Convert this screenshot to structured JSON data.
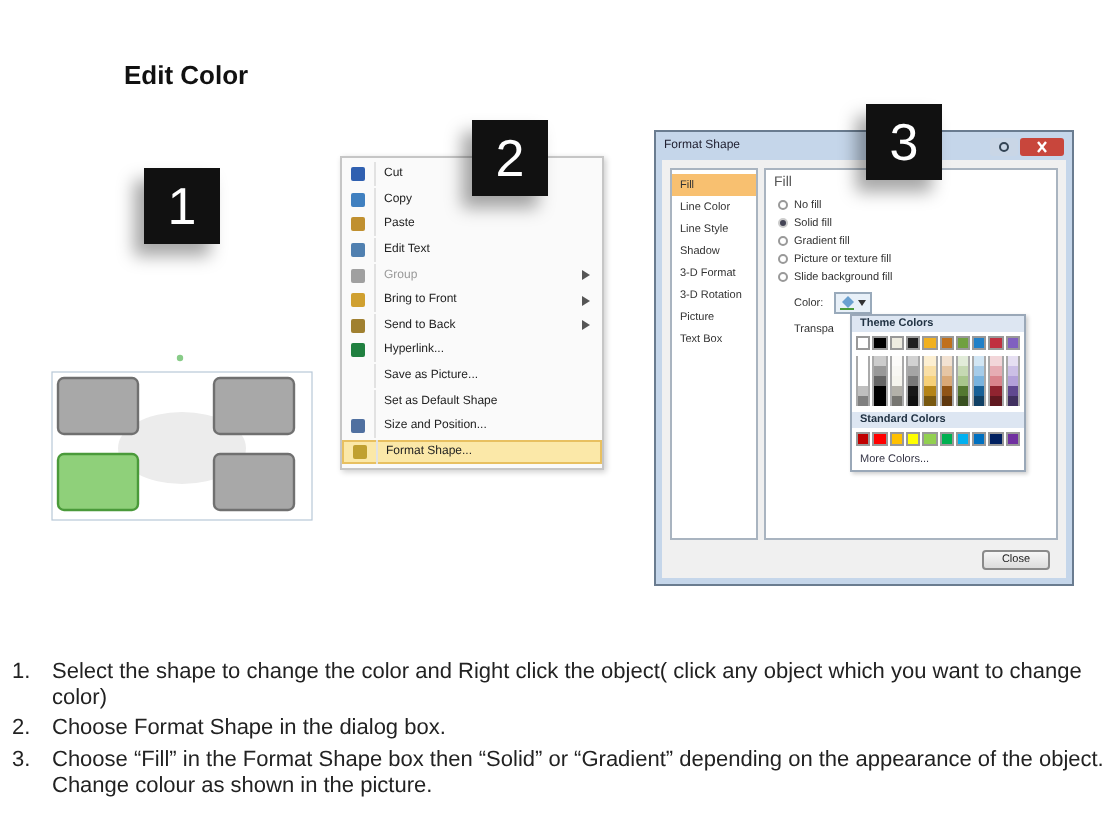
{
  "title": "Edit Color",
  "diagram": {
    "badge": "1",
    "shapes": [
      {
        "selected": false
      },
      {
        "selected": false
      },
      {
        "selected": true
      },
      {
        "selected": false
      }
    ]
  },
  "context_menu": {
    "badge": "2",
    "items": [
      {
        "label": "Cut",
        "submenu": false,
        "disabled": false,
        "selected": false
      },
      {
        "label": "Copy",
        "submenu": false,
        "disabled": false,
        "selected": false
      },
      {
        "label": "Paste",
        "submenu": false,
        "disabled": false,
        "selected": false
      },
      {
        "label": "Edit Text",
        "submenu": false,
        "disabled": false,
        "selected": false
      },
      {
        "label": "Group",
        "submenu": true,
        "disabled": true,
        "selected": false
      },
      {
        "label": "Bring to Front",
        "submenu": true,
        "disabled": false,
        "selected": false
      },
      {
        "label": "Send to Back",
        "submenu": true,
        "disabled": false,
        "selected": false
      },
      {
        "label": "Hyperlink...",
        "submenu": false,
        "disabled": false,
        "selected": false
      },
      {
        "label": "Save as Picture...",
        "submenu": false,
        "disabled": false,
        "selected": false
      },
      {
        "label": "Set as Default Shape",
        "submenu": false,
        "disabled": false,
        "selected": false
      },
      {
        "label": "Size and Position...",
        "submenu": false,
        "disabled": false,
        "selected": false
      },
      {
        "label": "Format Shape...",
        "submenu": false,
        "disabled": false,
        "selected": true
      }
    ]
  },
  "dialog": {
    "badge": "3",
    "title": "Format Shape",
    "categories": [
      {
        "label": "Fill",
        "selected": true
      },
      {
        "label": "Line Color",
        "selected": false
      },
      {
        "label": "Line Style",
        "selected": false
      },
      {
        "label": "Shadow",
        "selected": false
      },
      {
        "label": "3-D Format",
        "selected": false
      },
      {
        "label": "3-D Rotation",
        "selected": false
      },
      {
        "label": "Picture",
        "selected": false
      },
      {
        "label": "Text Box",
        "selected": false
      }
    ],
    "heading": "Fill",
    "options": [
      {
        "label": "No fill",
        "selected": false
      },
      {
        "label": "Solid fill",
        "selected": true
      },
      {
        "label": "Gradient fill",
        "selected": false
      },
      {
        "label": "Picture or texture fill",
        "selected": false
      },
      {
        "label": "Slide background fill",
        "selected": false
      }
    ],
    "color_label": "Color:",
    "transparency_label": "Transpa",
    "palette": {
      "theme_heading": "Theme Colors",
      "theme_colors": [
        {
          "color": "#ffffff"
        },
        {
          "color": "#000000"
        },
        {
          "color": "#eeece1"
        },
        {
          "color": "#1f1f1f"
        },
        {
          "color": "#f0b020"
        },
        {
          "color": "#c0701c"
        },
        {
          "color": "#70a040"
        },
        {
          "color": "#2080c8"
        },
        {
          "color": "#c03040"
        },
        {
          "color": "#8060c0"
        }
      ],
      "standard_heading": "Standard Colors",
      "standard_colors": [
        {
          "color": "#c00000"
        },
        {
          "color": "#ff0000"
        },
        {
          "color": "#ffc000"
        },
        {
          "color": "#ffff00"
        },
        {
          "color": "#92d050"
        },
        {
          "color": "#00b050"
        },
        {
          "color": "#00b0f0"
        },
        {
          "color": "#0070c0"
        },
        {
          "color": "#002060"
        },
        {
          "color": "#7030a0"
        }
      ],
      "more": "More Colors..."
    },
    "close_button": "Close"
  },
  "steps": [
    {
      "number": "1.",
      "text": "Select the shape to change the color and Right click the object( click any object which you want to change color)"
    },
    {
      "number": "2.",
      "text": "Choose Format Shape in the dialog box."
    },
    {
      "number": "3.",
      "text": "Choose “Fill” in the Format Shape box then “Solid” or “Gradient” depending on the appearance of the object. Change colour as shown in the picture."
    }
  ]
}
